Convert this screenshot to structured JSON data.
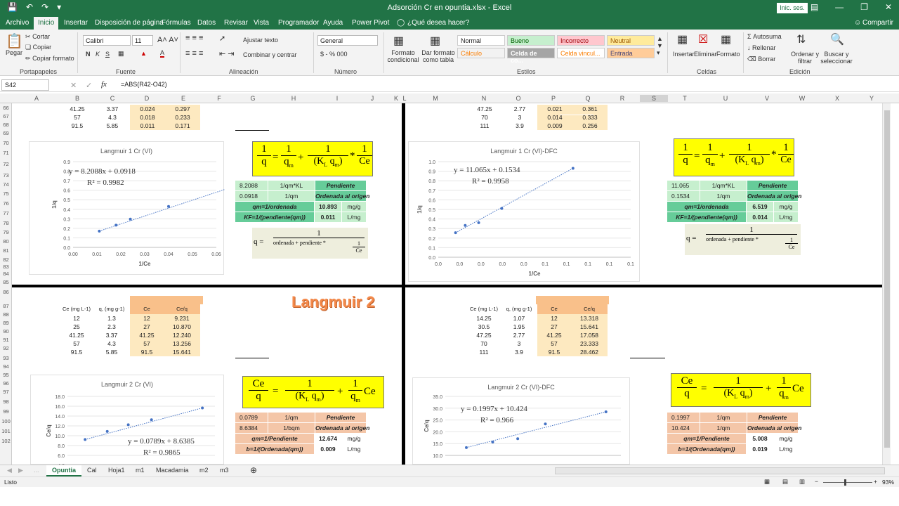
{
  "window": {
    "title": "Adsorción Cr en opuntia.xlsx  -  Excel",
    "signin": "Inic. ses.",
    "qat_icons": [
      "save-icon",
      "undo-icon",
      "redo-icon",
      "customize-icon"
    ]
  },
  "tabs": [
    "Archivo",
    "Inicio",
    "Insertar",
    "Disposición de página",
    "Fórmulas",
    "Datos",
    "Revisar",
    "Vista",
    "Programador",
    "Ayuda",
    "Power Pivot",
    "¿Qué desea hacer?",
    "Compartir"
  ],
  "ribbon": {
    "clipboard": {
      "paste": "Pegar",
      "cut": "Cortar",
      "copy": "Copiar",
      "format_painter": "Copiar formato",
      "label": "Portapapeles"
    },
    "font": {
      "name": "Calibri",
      "size": "11",
      "label": "Fuente",
      "bold": "N",
      "italic": "K",
      "underline": "S"
    },
    "alignment": {
      "wrap": "Ajustar texto",
      "merge": "Combinar y centrar",
      "label": "Alineación"
    },
    "number": {
      "format": "General",
      "label": "Número",
      "symbols": "$  -  %  000"
    },
    "styles": {
      "cond": "Formato condicional",
      "table": "Dar formato como tabla",
      "normal": "Normal",
      "bueno": "Bueno",
      "incorrecto": "Incorrecto",
      "neutral": "Neutral",
      "calculo": "Cálculo",
      "celda_co": "Celda de co...",
      "celda_vin": "Celda vincul...",
      "entrada": "Entrada",
      "label": "Estilos"
    },
    "cells": {
      "insert": "Insertar",
      "delete": "Eliminar",
      "format": "Formato",
      "label": "Celdas"
    },
    "editing": {
      "autosum": "Autosuma",
      "fill": "Rellenar",
      "clear": "Borrar",
      "sort": "Ordenar y filtrar",
      "find": "Buscar y seleccionar",
      "label": "Edición"
    }
  },
  "formula_bar": {
    "namebox": "S42",
    "formula": "=ABS(R42-O42)",
    "fx": "fx"
  },
  "columns": [
    "A",
    "B",
    "C",
    "D",
    "E",
    "F",
    "G",
    "H",
    "I",
    "J",
    "K",
    "L",
    "M",
    "N",
    "O",
    "P",
    "Q",
    "R",
    "S",
    "T",
    "U",
    "V",
    "W",
    "X",
    "Y"
  ],
  "rows": [
    "66",
    "67",
    "68",
    "69",
    "70",
    "71",
    "72",
    "73",
    "74",
    "75",
    "76",
    "77",
    "78",
    "79",
    "80",
    "81",
    "82",
    "83",
    "84",
    "85",
    "86",
    "87",
    "88",
    "89",
    "90",
    "91",
    "92",
    "93",
    "94",
    "95",
    "96",
    "97",
    "98",
    "99",
    "100",
    "101",
    "102"
  ],
  "q1": {
    "top_rows": [
      [
        "41.25",
        "3.37",
        "0.024",
        "0.297"
      ],
      [
        "57",
        "4.3",
        "0.018",
        "0.233"
      ],
      [
        "91.5",
        "5.85",
        "0.011",
        "0.171"
      ]
    ],
    "chart_title": "Langmuir 1  Cr (VI)",
    "eq": "y = 8.2088x + 0.0918",
    "r2": "R² = 0.9982",
    "ylabel": "1/q",
    "xlabel": "1/Ce",
    "yticks": [
      "0.9",
      "0.8",
      "0.7",
      "0.6",
      "0.5",
      "0.4",
      "0.3",
      "0.2",
      "0.1",
      "0.0"
    ],
    "xticks": [
      "0.00",
      "0.01",
      "0.02",
      "0.03",
      "0.04",
      "0.05",
      "0.06"
    ],
    "table": [
      [
        "8.2088",
        "1/qm*KL",
        "Pendiente"
      ],
      [
        "0.0918",
        "1/qm",
        "Ordenada al origen"
      ],
      [
        "qm=1/ordenada",
        "10.893",
        "mg/g"
      ],
      [
        "KF=1/(pendiente(qm))",
        "0.011",
        "L/mg"
      ]
    ]
  },
  "q2": {
    "top_rows": [
      [
        "47.25",
        "2.77",
        "0.021",
        "0.361"
      ],
      [
        "70",
        "3",
        "0.014",
        "0.333"
      ],
      [
        "111",
        "3.9",
        "0.009",
        "0.256"
      ]
    ],
    "chart_title": "Langmuir 1  Cr (VI)-DFC",
    "eq": "y = 11.065x + 0.1534",
    "r2": "R² = 0.9958",
    "ylabel": "1/q",
    "xlabel": "1/Ce",
    "yticks": [
      "1.0",
      "0.9",
      "0.8",
      "0.7",
      "0.6",
      "0.5",
      "0.4",
      "0.3",
      "0.2",
      "0.1",
      "0.0"
    ],
    "xticks": [
      "0.0",
      "0.0",
      "0.0",
      "0.0",
      "0.0",
      "0.1",
      "0.1",
      "0.1",
      "0.1",
      "0.1"
    ],
    "table": [
      [
        "11.065",
        "1/qm*KL",
        "Pendiente"
      ],
      [
        "0.1534",
        "1/qm",
        "Ordenada al origen"
      ],
      [
        "qm=1/ordenada",
        "6.519",
        "mg/g"
      ],
      [
        "KF=1/(pendiente(qm))",
        "0.014",
        "L/mg"
      ]
    ]
  },
  "formula_text": {
    "one": "1",
    "q": "q",
    "qm": "q",
    "m": "m",
    "KL": "K",
    "L": "L",
    "Ce": "Ce",
    "eq": "=",
    "plus": "+",
    "star": "*",
    "ordenada": "ordenada + pendiente *"
  },
  "q3": {
    "heading": "Langmuir 2",
    "headers": [
      "Ce (mg L-1)",
      "q, (mg g-1)",
      "Ce",
      "Ce/q"
    ],
    "rows": [
      [
        "12",
        "1.3",
        "12",
        "9.231"
      ],
      [
        "25",
        "2.3",
        "27",
        "10.870"
      ],
      [
        "41.25",
        "3.37",
        "41.25",
        "12.240"
      ],
      [
        "57",
        "4.3",
        "57",
        "13.256"
      ],
      [
        "91.5",
        "5.85",
        "91.5",
        "15.641"
      ]
    ],
    "chart_title": "Langmuir 2  Cr (VI)",
    "eq": "y = 0.0789x + 8.6385",
    "r2": "R² = 0.9865",
    "ylabel": "Ce/q",
    "yticks": [
      "18.0",
      "16.0",
      "14.0",
      "12.0",
      "10.0",
      "8.0",
      "6.0",
      "4.0"
    ],
    "table": [
      [
        "0.0789",
        "1/qm",
        "Pendiente"
      ],
      [
        "8.6384",
        "1/bqm",
        "Ordenada al origen"
      ],
      [
        "qm=1/Pendiente",
        "12.674",
        "mg/g"
      ],
      [
        "b=1/(Ordenada(qm))",
        "0.009",
        "L/mg"
      ]
    ]
  },
  "q4": {
    "headers": [
      "Ce (mg L-1)",
      "q, (mg g-1)",
      "Ce",
      "Ce/q"
    ],
    "rows": [
      [
        "14.25",
        "1.07",
        "12",
        "13.318"
      ],
      [
        "30.5",
        "1.95",
        "27",
        "15.641"
      ],
      [
        "47.25",
        "2.77",
        "41.25",
        "17.058"
      ],
      [
        "70",
        "3",
        "57",
        "23.333"
      ],
      [
        "111",
        "3.9",
        "91.5",
        "28.462"
      ]
    ],
    "chart_title": "Langmuir 2  Cr (VI)-DFC",
    "eq": "y = 0.1997x + 10.424",
    "r2": "R² = 0.966",
    "ylabel": "Ce/q",
    "yticks": [
      "35.0",
      "30.0",
      "25.0",
      "20.0",
      "15.0",
      "10.0"
    ],
    "table": [
      [
        "0.1997",
        "1/qm",
        "Pendiente"
      ],
      [
        "10.424",
        "1/qm",
        "Ordenada al origen"
      ],
      [
        "qm=1/Pendiente",
        "5.008",
        "mg/g"
      ],
      [
        "b=1/(Ordenada(qm))",
        "0.019",
        "L/mg"
      ]
    ]
  },
  "sheets": [
    "Opuntia",
    "Cal",
    "Hoja1",
    "m1",
    "Macadamia",
    "m2",
    "m3"
  ],
  "status": {
    "mode": "Listo",
    "zoom": "93%"
  },
  "chart_data": [
    {
      "type": "scatter",
      "title": "Langmuir 1  Cr (VI)",
      "xlabel": "1/Ce",
      "ylabel": "1/q",
      "x": [
        0.011,
        0.018,
        0.024,
        0.04,
        0.083
      ],
      "y": [
        0.171,
        0.233,
        0.297,
        0.43,
        0.77
      ],
      "xlim": [
        0,
        0.06
      ],
      "ylim": [
        0,
        0.9
      ]
    },
    {
      "type": "scatter",
      "title": "Langmuir 1  Cr (VI)-DFC",
      "xlabel": "1/Ce",
      "ylabel": "1/q",
      "x": [
        0.009,
        0.014,
        0.021,
        0.033,
        0.07
      ],
      "y": [
        0.256,
        0.333,
        0.361,
        0.51,
        0.93
      ],
      "xlim": [
        0,
        0.1
      ],
      "ylim": [
        0,
        1.0
      ]
    },
    {
      "type": "scatter",
      "title": "Langmuir 2  Cr (VI)",
      "ylabel": "Ce/q",
      "x": [
        12,
        27,
        41.25,
        57,
        91.5
      ],
      "y": [
        9.231,
        10.87,
        12.24,
        13.256,
        15.641
      ],
      "ylim": [
        4,
        18
      ]
    },
    {
      "type": "scatter",
      "title": "Langmuir 2  Cr (VI)-DFC",
      "ylabel": "Ce/q",
      "x": [
        12,
        27,
        41.25,
        57,
        91.5
      ],
      "y": [
        13.318,
        15.641,
        17.058,
        23.333,
        28.462
      ],
      "ylim": [
        10,
        35
      ]
    }
  ]
}
